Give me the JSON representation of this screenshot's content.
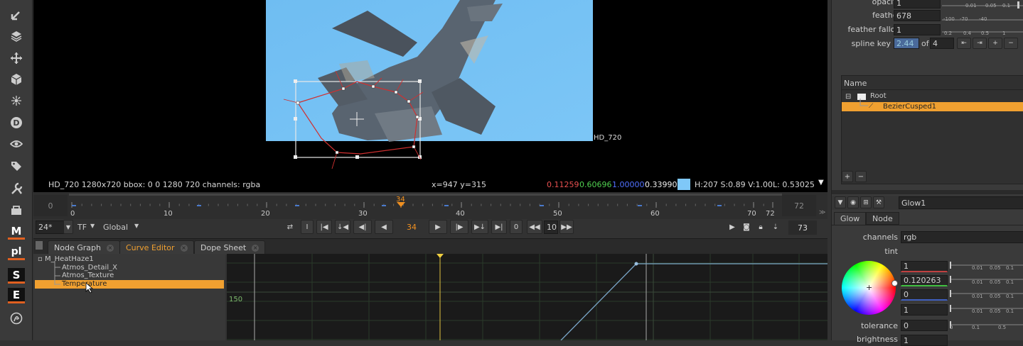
{
  "toolbar": {
    "icons": [
      "viewer-tool-icon",
      "layers-icon",
      "transform-icon",
      "3d-cube-icon",
      "particles-icon",
      "deep-icon",
      "eye-icon",
      "tags-icon",
      "wrench-icon",
      "toolsets-icon"
    ],
    "text_icons": [
      "M",
      "pl",
      "S",
      "E"
    ],
    "last_icon": "nukex-icon"
  },
  "viewer": {
    "format_label": "HD_720",
    "status": {
      "info": "HD_720 1280x720  bbox: 0 0 1280 720 channels: rgba",
      "coords": "x=947 y=315",
      "r": "0.11259",
      "g": "0.60696",
      "b": "1.00000",
      "a": "0.33990",
      "swatch_color": "#7fc8f8",
      "hsv": "H:207 S:0.89 V:1.00",
      "lum": "L: 0.53025"
    }
  },
  "timeline": {
    "start": "0",
    "end": "72",
    "current": "34",
    "ticks": [
      "0",
      "10",
      "20",
      "30",
      "40",
      "50",
      "60",
      "70",
      "72"
    ],
    "marker": "34"
  },
  "controls": {
    "fps": "24*",
    "tf": "TF",
    "global": "Global",
    "frame": "34",
    "increment": "10",
    "end_frame": "73",
    "one_label": "I",
    "zero_label": "0"
  },
  "tabs": [
    {
      "label": "Node Graph"
    },
    {
      "label": "Curve Editor"
    },
    {
      "label": "Dope Sheet"
    }
  ],
  "tree": {
    "root": "M_HeatHaze1",
    "items": [
      "Atmos_Detail_X",
      "Atmos_Texture",
      "Temperature"
    ]
  },
  "curve": {
    "y_label": "150"
  },
  "rpanel": {
    "opacity": {
      "label": "opacity",
      "value": "1"
    },
    "feather": {
      "label": "feather",
      "value": "678"
    },
    "feather_falloff": {
      "label": "feather falloff",
      "value": "1"
    },
    "spline_key": {
      "label": "spline key",
      "value": "2.44",
      "of": "of",
      "total": "4"
    },
    "slider_ticks_a": [
      "-100",
      "-70",
      "-40",
      "0.01",
      "0.05",
      "0.1"
    ],
    "slider_ticks_b": [
      "0.2",
      "0.4",
      "0.5",
      "1"
    ],
    "layers_header": "Name",
    "layers": [
      {
        "label": "Root"
      },
      {
        "label": "BezierCusped1"
      }
    ],
    "node_name": "Glow1",
    "node_tabs": [
      "Glow",
      "Node"
    ],
    "channels": {
      "label": "channels",
      "value": "rgb"
    },
    "tint": {
      "label": "tint",
      "values": [
        "1",
        "0.120263",
        "0",
        "1"
      ]
    },
    "tolerance": {
      "label": "tolerance",
      "value": "0"
    },
    "brightness": {
      "label": "brightness",
      "value": "1"
    },
    "mini_ticks": [
      "0.01",
      "0.05",
      "0.1"
    ],
    "tol_ticks": [
      "0",
      "0.1",
      "0.5"
    ]
  }
}
